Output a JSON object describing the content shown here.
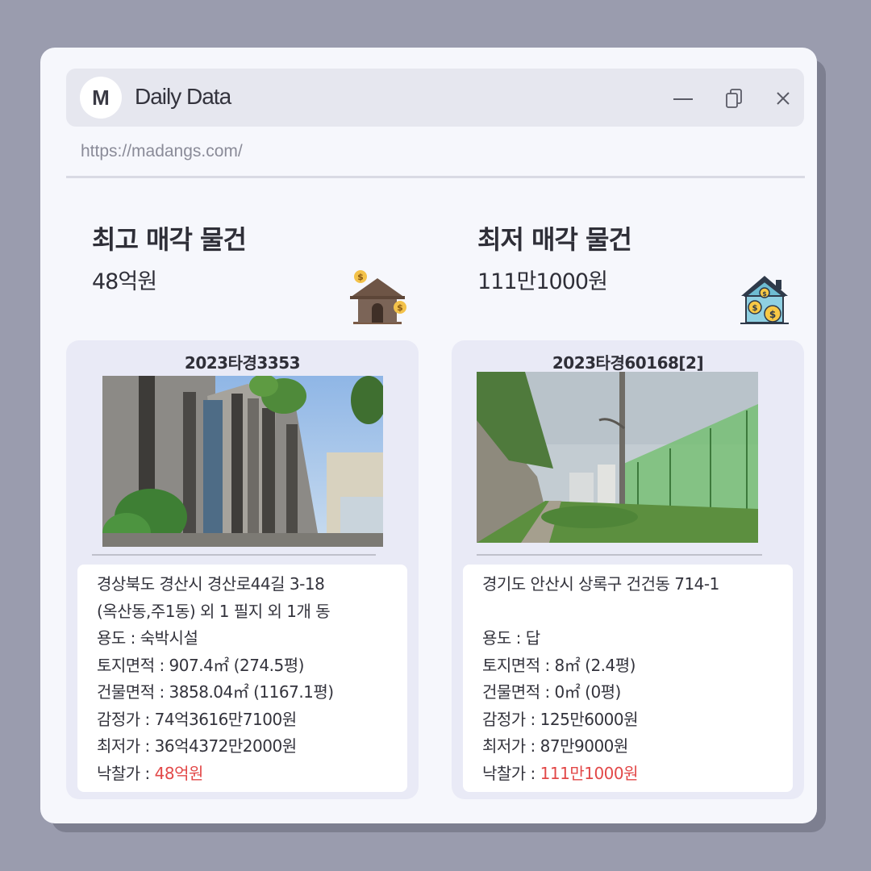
{
  "window": {
    "logo_letter": "M",
    "title": "Daily Data",
    "url": "https://madangs.com/"
  },
  "highest": {
    "heading": "최고 매각 물건",
    "amount": "48억원",
    "case_no": "2023타경3353",
    "address_line1": "경상북도 경산시 경산로44길 3-18",
    "address_line2": "(옥산동,주1동) 외 1 필지 외 1개 동",
    "usage": "용도 : 숙박시설",
    "land_area": "토지면적 : 907.4㎡ (274.5평)",
    "building_area": "건물면적 : 3858.04㎡ (1167.1평)",
    "appraisal": "감정가 : 74억3616만7100원",
    "minimum": "최저가 : 36억4372만2000원",
    "winning_label": "낙찰가 : ",
    "winning_value": "48억원"
  },
  "lowest": {
    "heading": "최저 매각 물건",
    "amount": "111만1000원",
    "case_no": "2023타경60168[2]",
    "address_line1": "경기도 안산시 상록구 건건동 714-1",
    "address_line2": "",
    "usage": "용도 : 답",
    "land_area": "토지면적 : 8㎡ (2.4평)",
    "building_area": "건물면적 : 0㎡ (0평)",
    "appraisal": "감정가 : 125만6000원",
    "minimum": "최저가 : 87만9000원",
    "winning_label": "낙찰가 : ",
    "winning_value": "111만1000원"
  },
  "icons": {
    "minimize": "minimize-icon",
    "restore": "restore-icon",
    "close": "close-icon",
    "high_house": "house-money-icon",
    "low_house": "house-coins-icon"
  },
  "colors": {
    "background": "#9a9cae",
    "window": "#f6f7fc",
    "card": "#e9eaf6",
    "price_highlight": "#e24848"
  }
}
